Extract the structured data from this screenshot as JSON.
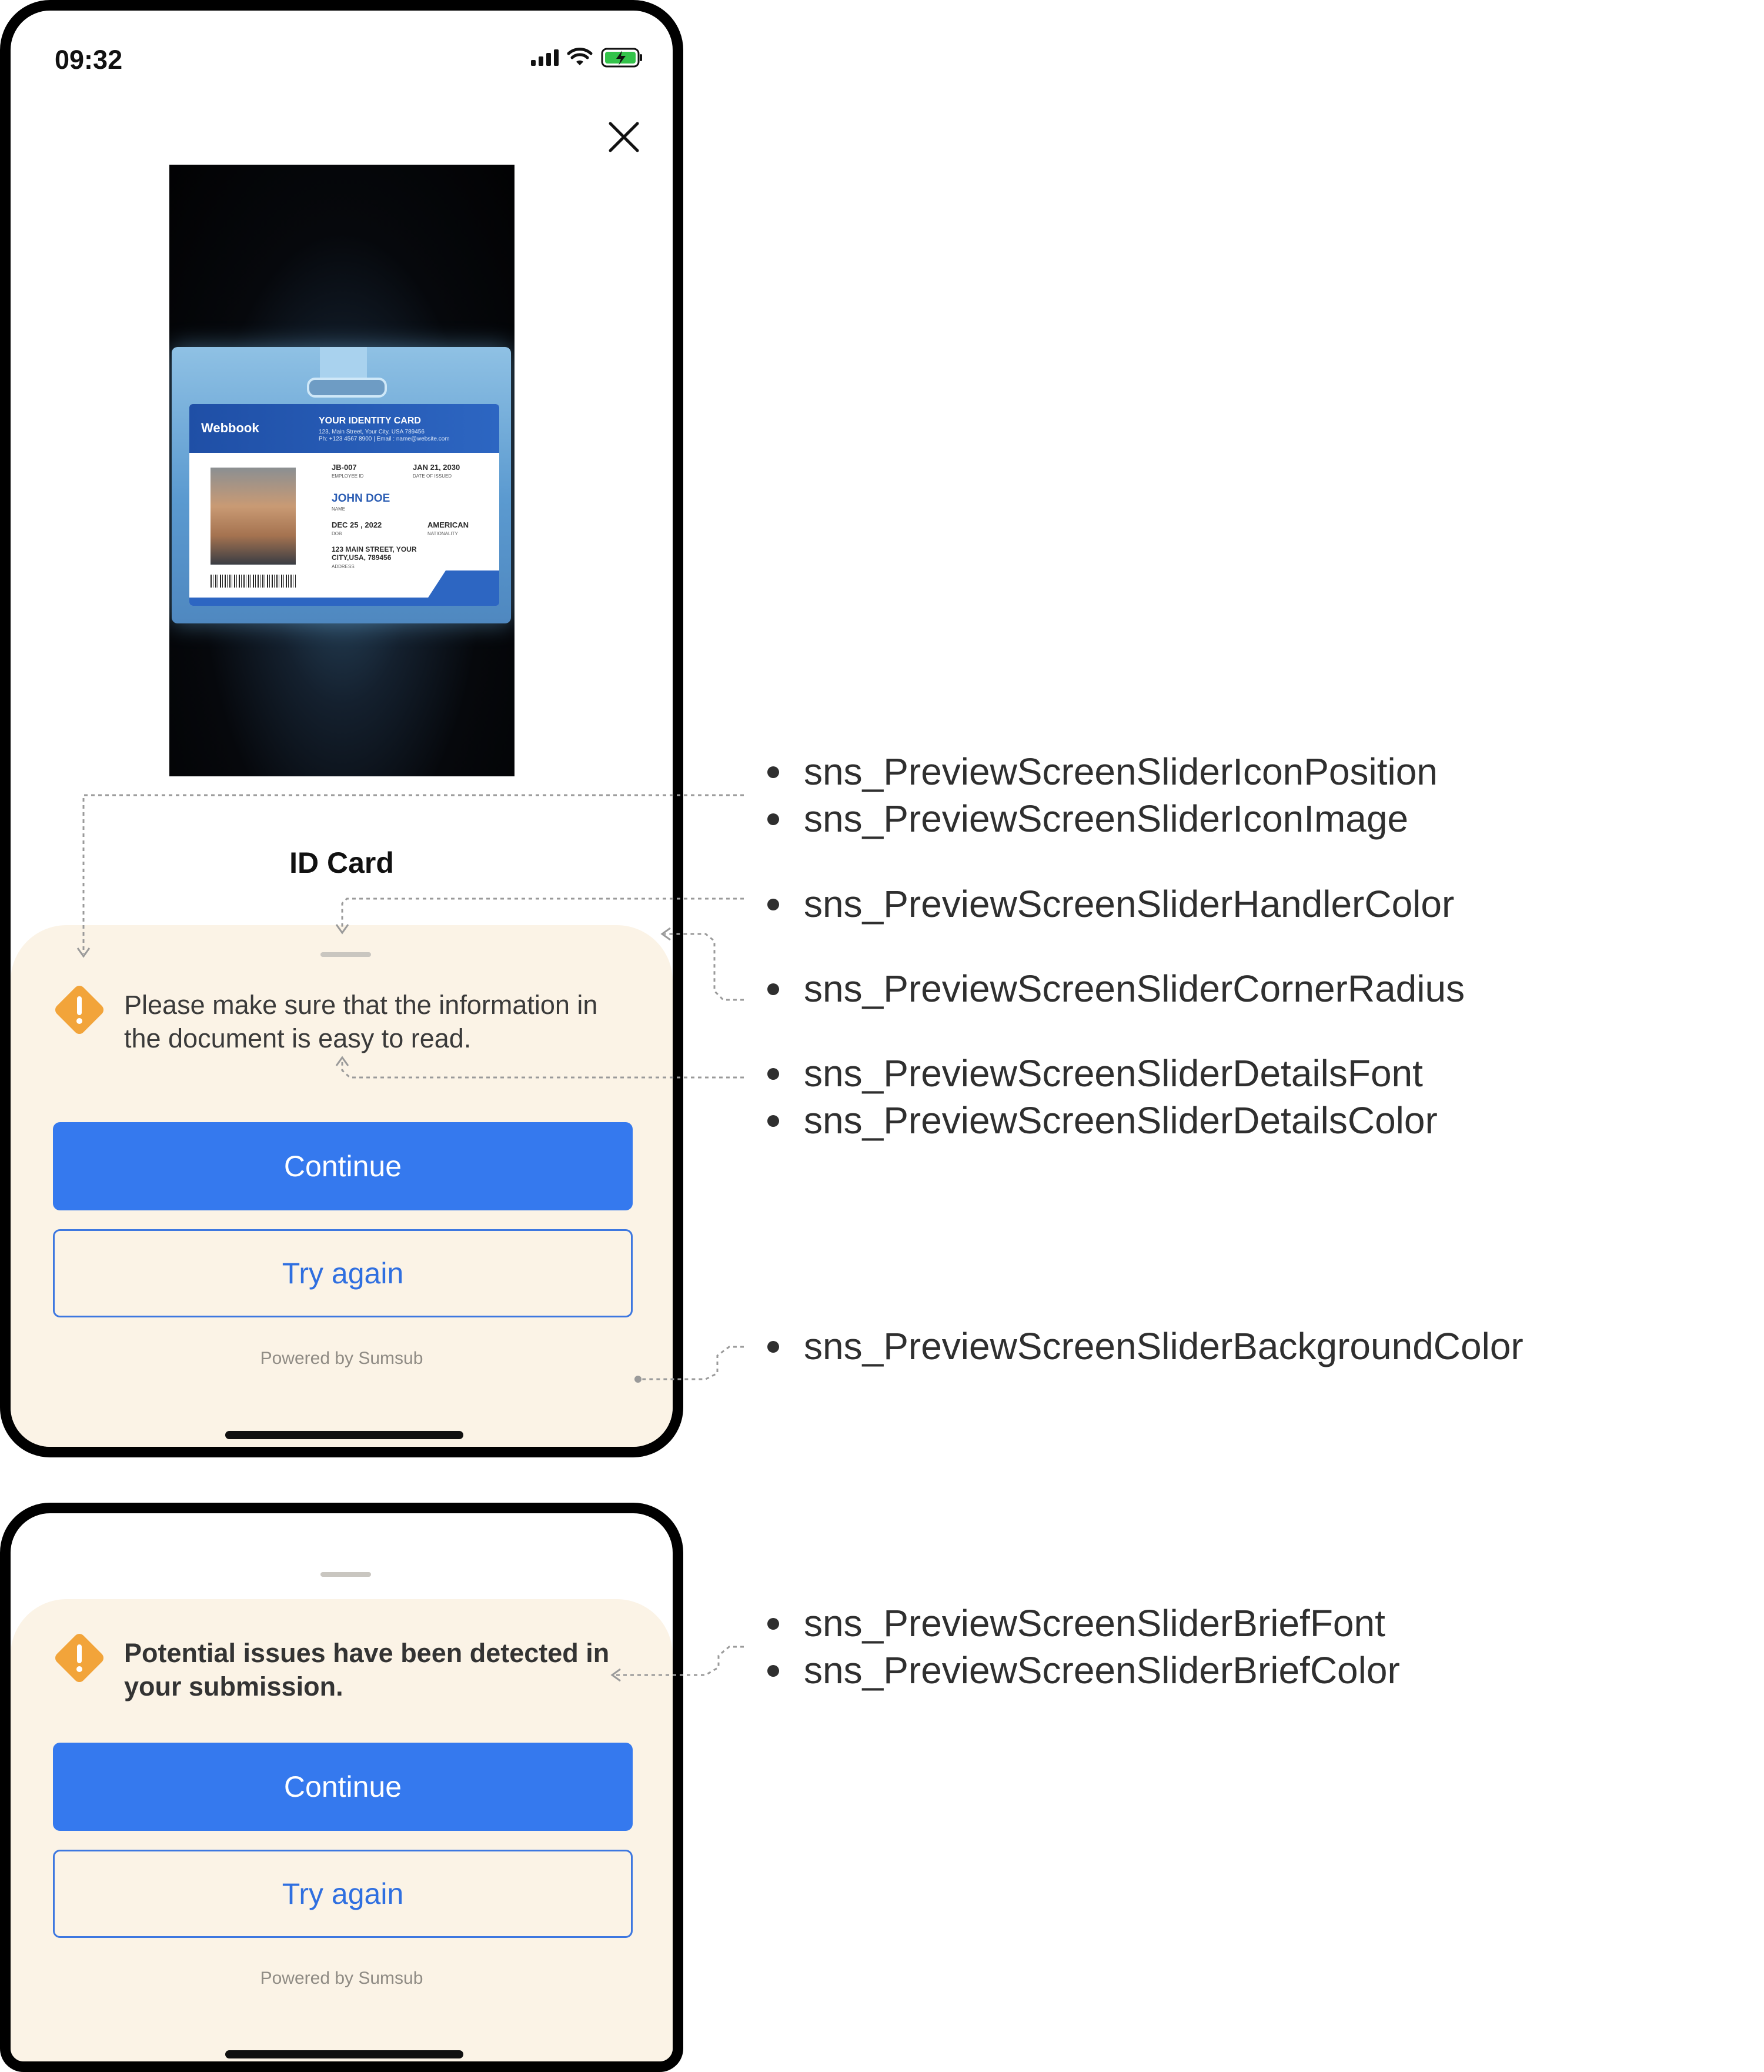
{
  "status_bar": {
    "time": "09:32",
    "icons": [
      "signal-icon",
      "wifi-icon",
      "battery-charging-icon"
    ]
  },
  "close_icon": "close-icon",
  "document": {
    "title": "ID Card",
    "photo": {
      "card_logo": "Webbook",
      "card_title": "YOUR IDENTITY CARD",
      "card_address_line1": "123, Main Street, Your City, USA 789456",
      "card_address_line2": "Ph: +123 4567 8900 | Email : name@website.com",
      "employee_id": "JB-007",
      "employee_id_label": "EMPLOYEE ID",
      "issue_date": "JAN 21, 2030",
      "issue_date_label": "DATE OF ISSUED",
      "name": "JOHN DOE",
      "name_label": "NAME",
      "dob": "DEC 25 , 2022",
      "dob_label": "DOB",
      "nationality": "AMERICAN",
      "nationality_label": "NATIONALITY",
      "address": "123 MAIN STREET, YOUR CITY,USA, 789456",
      "address_label": "ADDRESS"
    }
  },
  "slider_details": {
    "message": "Please make sure that the information in the document is easy to read.",
    "continue_label": "Continue",
    "try_again_label": "Try again",
    "powered_by": "Powered by Sumsub"
  },
  "slider_brief": {
    "message": "Potential issues have been detected in your submission.",
    "continue_label": "Continue",
    "try_again_label": "Try again",
    "powered_by": "Powered by Sumsub"
  },
  "colors": {
    "sheet_background": "#fbf3e6",
    "primary": "#3579ee",
    "warning": "#f2a43a"
  },
  "annotations": [
    "sns_PreviewScreenSliderIconPosition",
    "sns_PreviewScreenSliderIconImage",
    "sns_PreviewScreenSliderHandlerColor",
    "sns_PreviewScreenSliderCornerRadius",
    "sns_PreviewScreenSliderDetailsFont",
    "sns_PreviewScreenSliderDetailsColor",
    "sns_PreviewScreenSliderBackgroundColor",
    "sns_PreviewScreenSliderBriefFont",
    "sns_PreviewScreenSliderBriefColor"
  ]
}
